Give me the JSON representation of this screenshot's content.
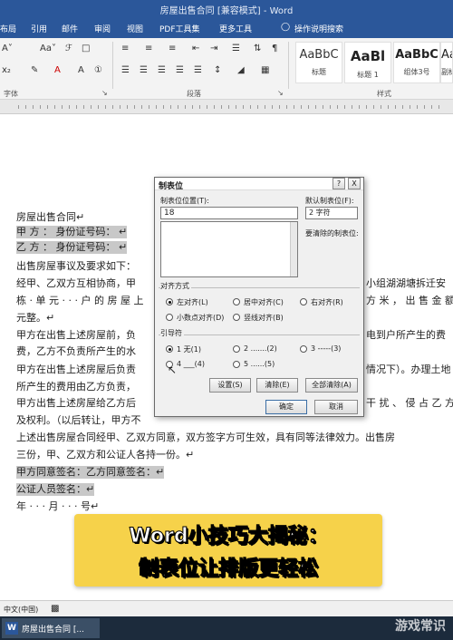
{
  "window": {
    "title": "房屋出售合同 [兼容模式] - Word"
  },
  "tabs": [
    "布局",
    "引用",
    "邮件",
    "审阅",
    "视图",
    "PDF工具集",
    "更多工具"
  ],
  "tell_me": "操作说明搜索",
  "ribbon": {
    "font_group_label": "字体",
    "paragraph_group_label": "段落",
    "styles_group_label": "样式",
    "styles": [
      {
        "sample": "AaBbC",
        "name": "标题"
      },
      {
        "sample": "AaBl",
        "name": "标题 1"
      },
      {
        "sample": "AaBbC",
        "name": "组体3号"
      },
      {
        "sample": "AaBb",
        "name": "副标"
      }
    ]
  },
  "document": {
    "lines": [
      "房屋出售合同↵",
      "甲 方 ： 身份证号码： ↵",
      "乙 方 ： 身份证号码： ↵",
      "出售房屋事议及要求如下：",
      "经甲、乙双方互相协商，甲",
      "栋 · 单 元 · · · 户 的 房 屋 上",
      "元整。↵",
      "甲方在出售上述房屋前，负",
      "费，乙方不负责所产生的水",
      "甲方在出售上述房屋后负责",
      "所产生的费用由乙方负责，",
      "甲方出售上述房屋给乙方后",
      "及权利。（以后转让，甲方不",
      "上述出售房屋合同经甲、乙双方同意，双方签字方可生效，具有同等法律效力。出售房",
      "三份，甲、乙双方和公证人各持一份。↵",
      "甲方同意签名：乙方同意签名：↵",
      "公证人员签名：↵",
      "年 · · · 月 · · · 号↵"
    ],
    "right_fragments": [
      "小组湖湖塘拆迁安",
      "方 米 ， 出 售 金 额",
      "电到户所产生的费",
      "情况下）。办理土地",
      "干 扰 、 侵 占 乙 方"
    ]
  },
  "dialog": {
    "title": "制表位",
    "help": "?",
    "close": "X",
    "tab_stop_label": "制表位位置(T):",
    "tab_stop_value": "18",
    "default_label": "默认制表位(F):",
    "default_value": "2 字符",
    "clear_label": "要清除的制表位:",
    "align_label": "对齐方式",
    "align_options": [
      "左对齐(L)",
      "居中对齐(C)",
      "右对齐(R)",
      "小数点对齐(D)",
      "竖线对齐(B)"
    ],
    "leader_label": "引导符",
    "leader_options": [
      "1 无(1)",
      "2 .......(2)",
      "3 -----(3)",
      "4 ___(4)",
      "5 ......(5)"
    ],
    "buttons": {
      "set": "设置(S)",
      "clear": "清除(E)",
      "clear_all": "全部清除(A)",
      "ok": "确定",
      "cancel": "取消"
    }
  },
  "banner": {
    "line1": "Word小技巧大揭秘：",
    "line2": "制表位让排版更轻松"
  },
  "status": {
    "language": "中文(中国)"
  },
  "taskbar": {
    "app_label": "房屋出售合同 [..."
  },
  "watermark": "游戏常识"
}
